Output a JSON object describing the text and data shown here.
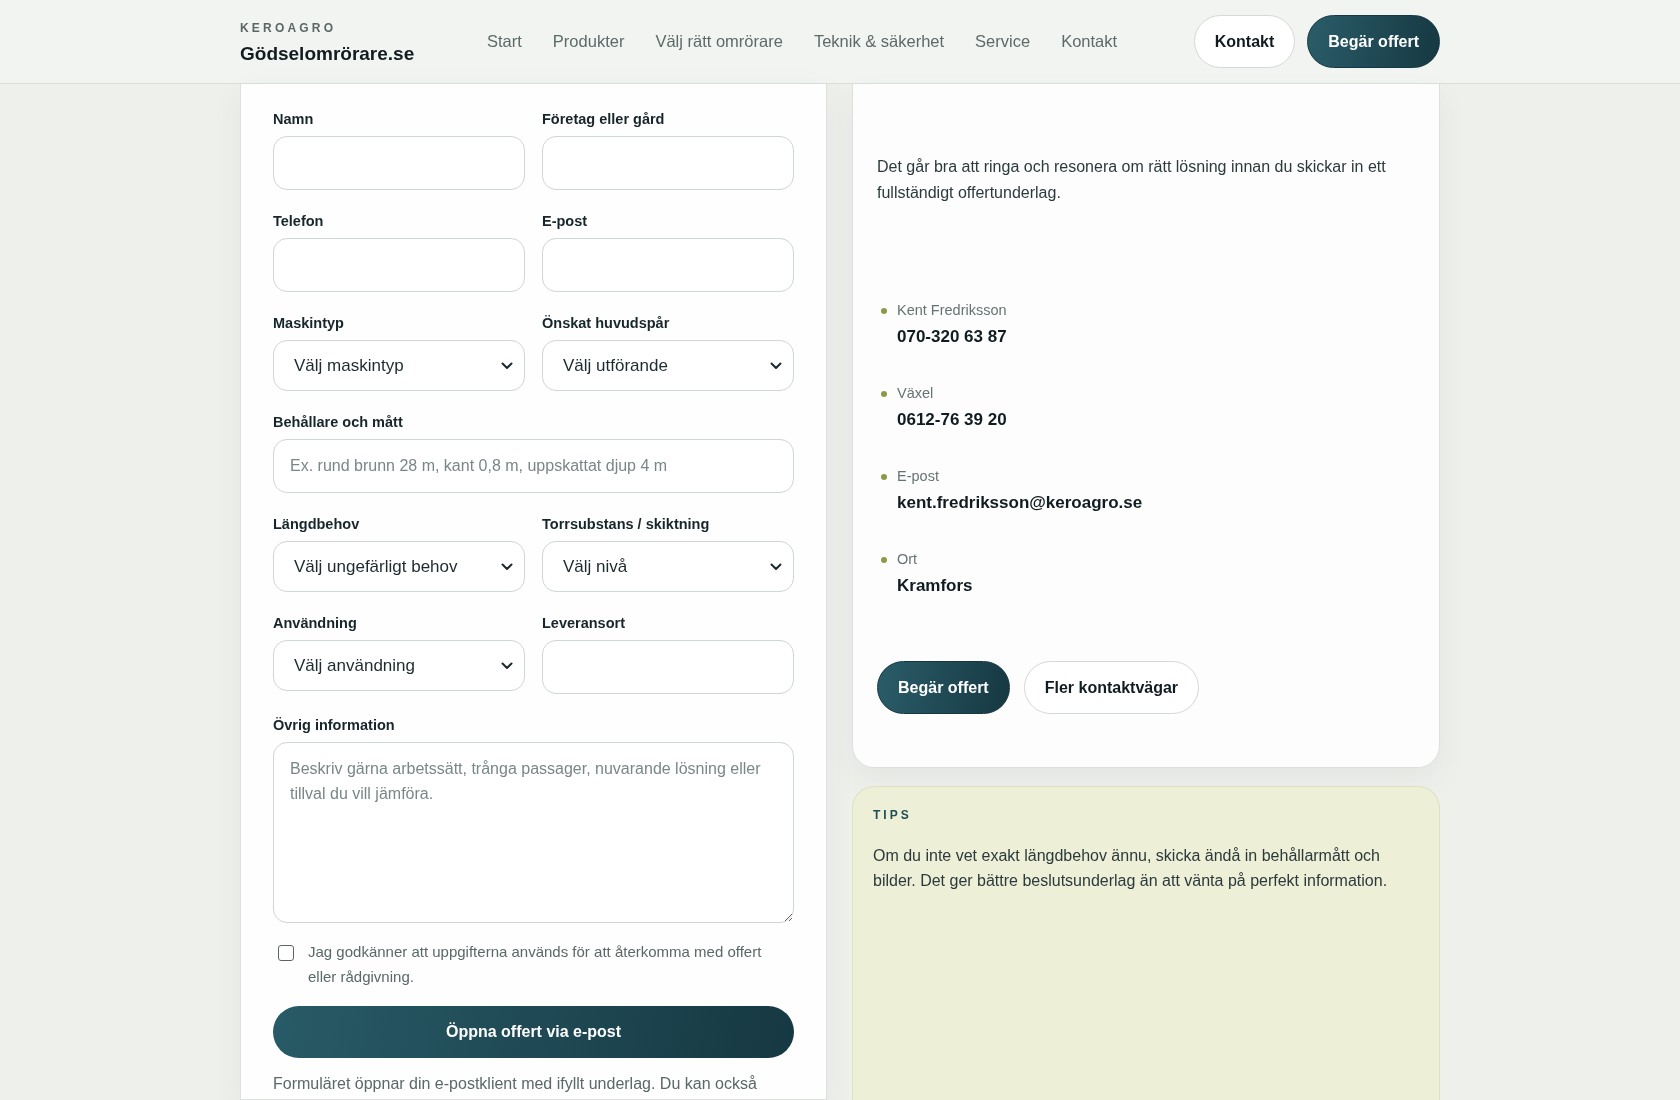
{
  "header": {
    "brand_kicker": "KEROAGRO",
    "brand_name": "Gödselomrörare.se",
    "nav": [
      {
        "label": "Start",
        "selected": false
      },
      {
        "label": "Produkter",
        "selected": false
      },
      {
        "label": "Välj rätt omrörare",
        "selected": false
      },
      {
        "label": "Teknik & säkerhet",
        "selected": false
      },
      {
        "label": "Service",
        "selected": false
      },
      {
        "label": "Kontakt",
        "selected": false
      }
    ],
    "actions": [
      {
        "label": "Kontakt",
        "kind": "secondary"
      },
      {
        "label": "Begär offert",
        "kind": "primary"
      }
    ]
  },
  "form": {
    "rows": [
      [
        {
          "label": "Namn",
          "kind": "text"
        },
        {
          "label": "Företag eller gård",
          "kind": "text"
        }
      ],
      [
        {
          "label": "Telefon",
          "kind": "text"
        },
        {
          "label": "E-post",
          "kind": "text"
        }
      ],
      [
        {
          "label": "Maskintyp",
          "kind": "select",
          "value": "Välj maskintyp"
        },
        {
          "label": "Önskat huvudspår",
          "kind": "select",
          "value": "Välj utförande"
        }
      ],
      [
        {
          "label": "Behållare och mått",
          "kind": "text",
          "placeholder": "Ex. rund brunn 28 m, kant 0,8 m, uppskattat djup 4 m"
        }
      ],
      [
        {
          "label": "Längdbehov",
          "kind": "select",
          "value": "Välj ungefärligt behov"
        },
        {
          "label": "Torrsubstans / skiktning",
          "kind": "select",
          "value": "Välj nivå"
        }
      ],
      [
        {
          "label": "Användning",
          "kind": "select",
          "value": "Välj användning"
        },
        {
          "label": "Leveransort",
          "kind": "text"
        }
      ],
      [
        {
          "label": "Övrig information",
          "kind": "textarea",
          "placeholder": "Beskriv gärna arbetssätt, trånga passager, nuvarande lösning eller tillval du vill jämföra."
        }
      ]
    ],
    "consent": {
      "label": "Jag godkänner att uppgifterna används för att återkomma med offert eller rådgivning.",
      "checked": false
    },
    "submit": "Öppna offert via e-post",
    "note": "Formuläret öppnar din e-postklient med ifyllt underlag. Du kan också"
  },
  "contact": {
    "intro": "Det går bra att ringa och resonera om rätt lösning innan du skickar in ett fullständigt offertunderlag.",
    "items": [
      {
        "label": "Kent Fredriksson",
        "value": "070-320 63 87"
      },
      {
        "label": "Växel",
        "value": "0612-76 39 20"
      },
      {
        "label": "E-post",
        "value": "kent.fredriksson@keroagro.se"
      },
      {
        "label": "Ort",
        "value": "Kramfors"
      }
    ],
    "actions": [
      {
        "label": "Begär offert",
        "kind": "primary"
      },
      {
        "label": "Fler kontaktvägar",
        "kind": "secondary"
      }
    ]
  },
  "tips": {
    "title": "TIPS",
    "text": "Om du inte vet exakt längdbehov ännu, skicka ändå in behållarmått och bilder. Det ger bättre beslutsunderlag än att vänta på perfekt information."
  }
}
